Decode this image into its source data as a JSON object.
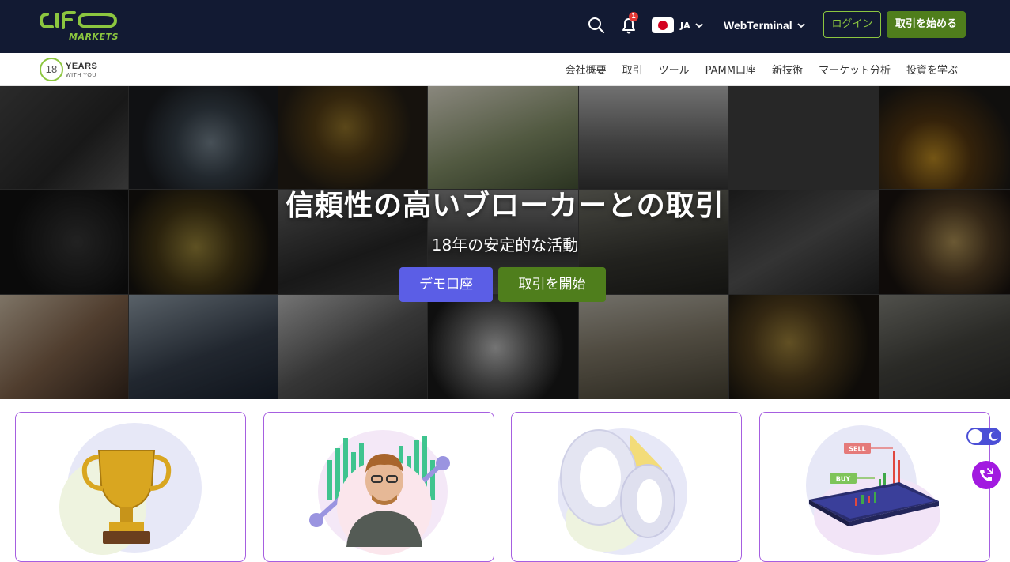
{
  "header": {
    "logo_text": "MARKETS",
    "notification_count": "1",
    "language_code": "JA",
    "webterminal_label": "WebTerminal",
    "login_label": "ログイン",
    "start_trading_label": "取引を始める"
  },
  "nav": {
    "years_number": "18",
    "years_label": "YEARS",
    "years_sub": "WITH YOU",
    "items": [
      "会社概要",
      "取引",
      "ツール",
      "PAMM口座",
      "新技術",
      "マーケット分析",
      "投資を学ぶ"
    ]
  },
  "hero": {
    "title": "信頼性の高いブローカーとの取引",
    "subtitle": "18年の安定的な活動",
    "demo_button": "デモ口座",
    "start_button": "取引を開始"
  },
  "cards": {
    "sell_label": "SELL",
    "buy_label": "BUY"
  },
  "colors": {
    "brand_green": "#8cc63f",
    "dark_navy": "#121a33",
    "demo_blue": "#5b5ee6",
    "action_green": "#4f7e1c",
    "card_border": "#a65fe0"
  }
}
